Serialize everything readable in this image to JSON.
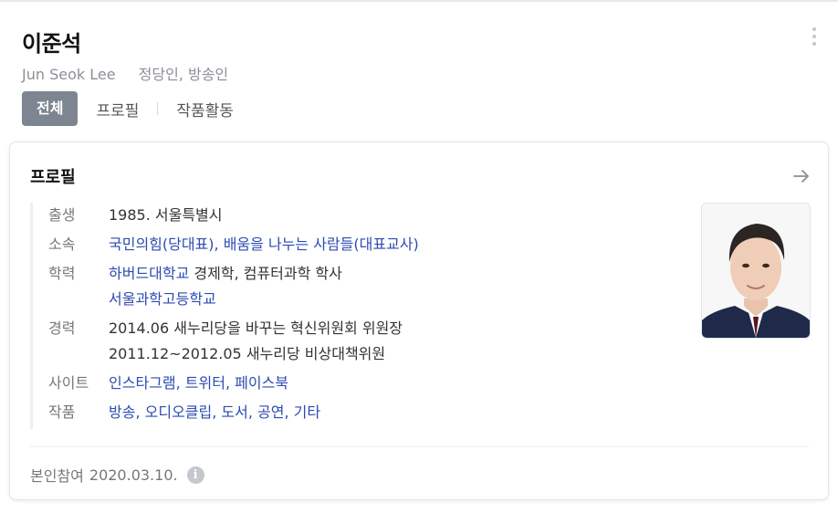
{
  "person": {
    "name": "이준석",
    "english_name": "Jun Seok Lee",
    "occupation": "정당인, 방송인"
  },
  "tabs": {
    "all": "전체",
    "profile": "프로필",
    "works": "작품활동"
  },
  "card": {
    "title": "프로필",
    "rows": {
      "birth": {
        "label": "출생",
        "value": "1985. 서울특별시"
      },
      "affiliation": {
        "label": "소속",
        "items": [
          "국민의힘(당대표), ",
          "배움을 나누는 사람들(대표교사)"
        ]
      },
      "education": {
        "label": "학력",
        "line1_link": "하버드대학교",
        "line1_rest": " 경제학, 컴퓨터과학 학사",
        "line2": "서울과학고등학교"
      },
      "career": {
        "label": "경력",
        "line1": "2014.06 새누리당을 바꾸는 혁신위원회 위원장",
        "line2": "2011.12~2012.05 새누리당 비상대책위원"
      },
      "sites": {
        "label": "사이트",
        "items": [
          "인스타그램, ",
          "트위터, ",
          "페이스북"
        ]
      },
      "works": {
        "label": "작품",
        "items": [
          "방송, ",
          "오디오클립, ",
          "도서, ",
          "공연, ",
          "기타"
        ]
      }
    },
    "footer": {
      "label": "본인참여",
      "date": "2020.03.10.",
      "info_icon": "i"
    }
  },
  "colors": {
    "link": "#2d4bb1",
    "tab_active_bg": "#7d8590",
    "muted": "#777777"
  },
  "icons": [
    "more-vertical-icon",
    "arrow-right-icon",
    "info-icon"
  ]
}
